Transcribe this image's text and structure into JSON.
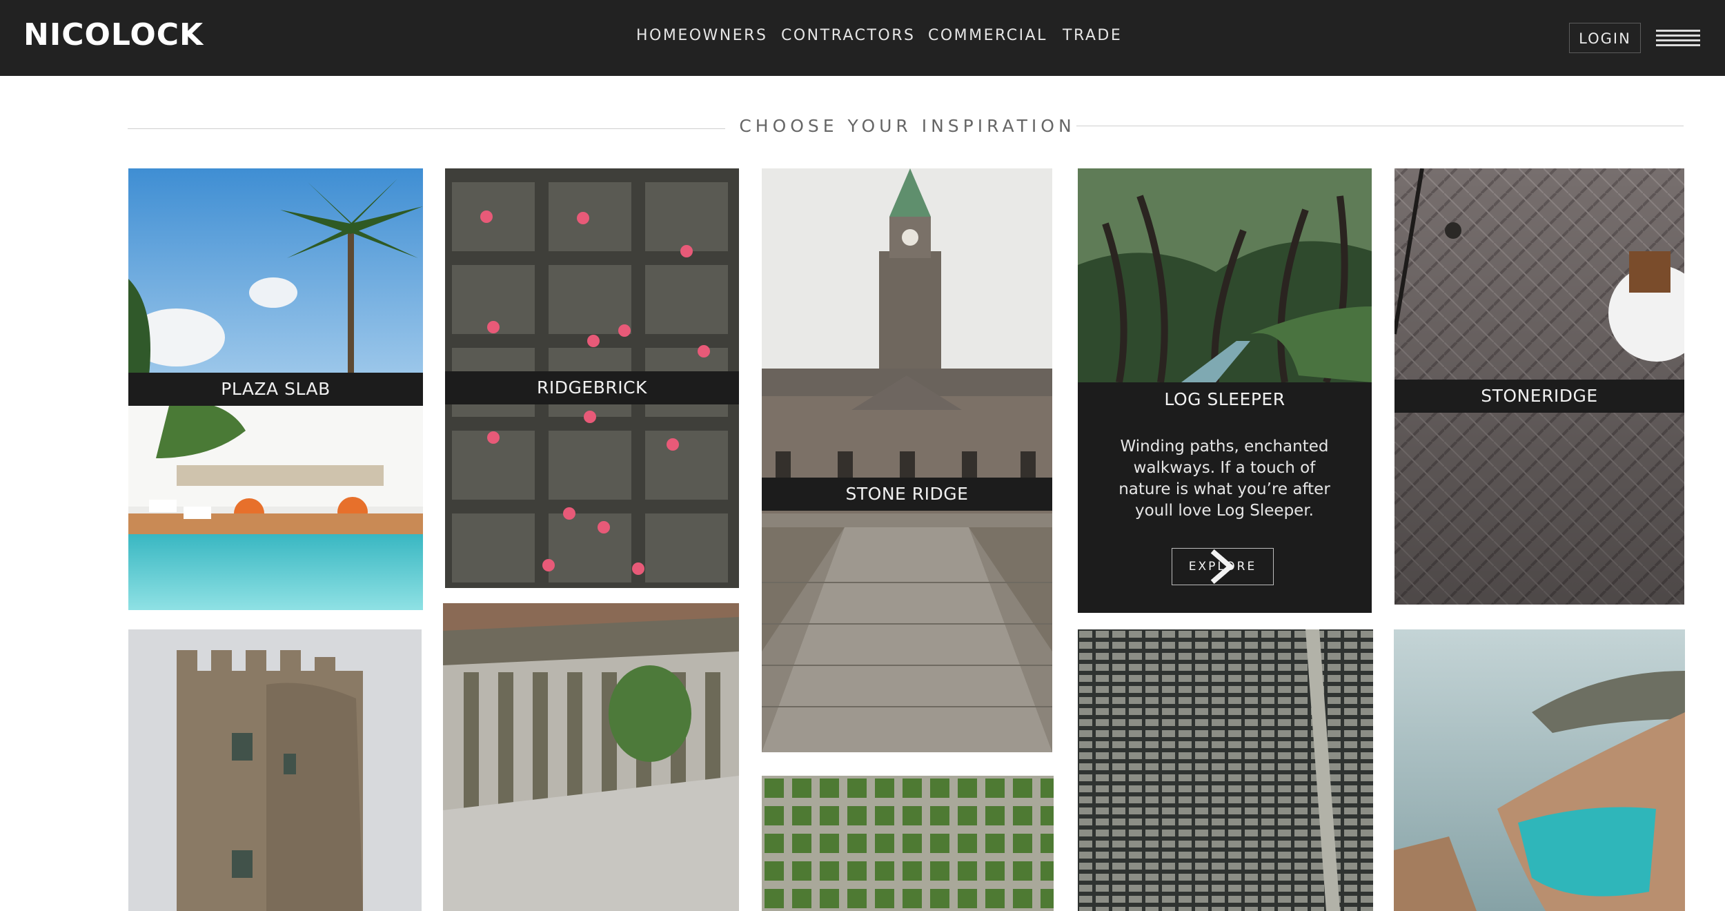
{
  "header": {
    "logo_text": "NICOLOCK",
    "nav": [
      "HOMEOWNERS",
      "CONTRACTORS",
      "COMMERCIAL",
      "TRADE"
    ],
    "login_label": "LOGIN",
    "menu_icon": "hamburger-menu-icon"
  },
  "main": {
    "section_title": "CHOOSE YOUR INSPIRATION",
    "tiles": [
      {
        "caption": "PLAZA SLAB"
      },
      {
        "caption": "RIDGEBRICK"
      },
      {
        "caption": "STONE RIDGE"
      },
      {
        "caption": "LOG SLEEPER",
        "description_lines": [
          "Winding paths, enchanted",
          "walkways.  If a touch of",
          "nature is what  you’re after",
          "youll love Log Sleeper."
        ],
        "button_label": "EXPLORE"
      },
      {
        "caption": "STONERIDGE"
      }
    ]
  },
  "colors": {
    "header_bg": "#222222",
    "caption_bg": "#1c1c1c",
    "page_bg": "#ffffff"
  }
}
